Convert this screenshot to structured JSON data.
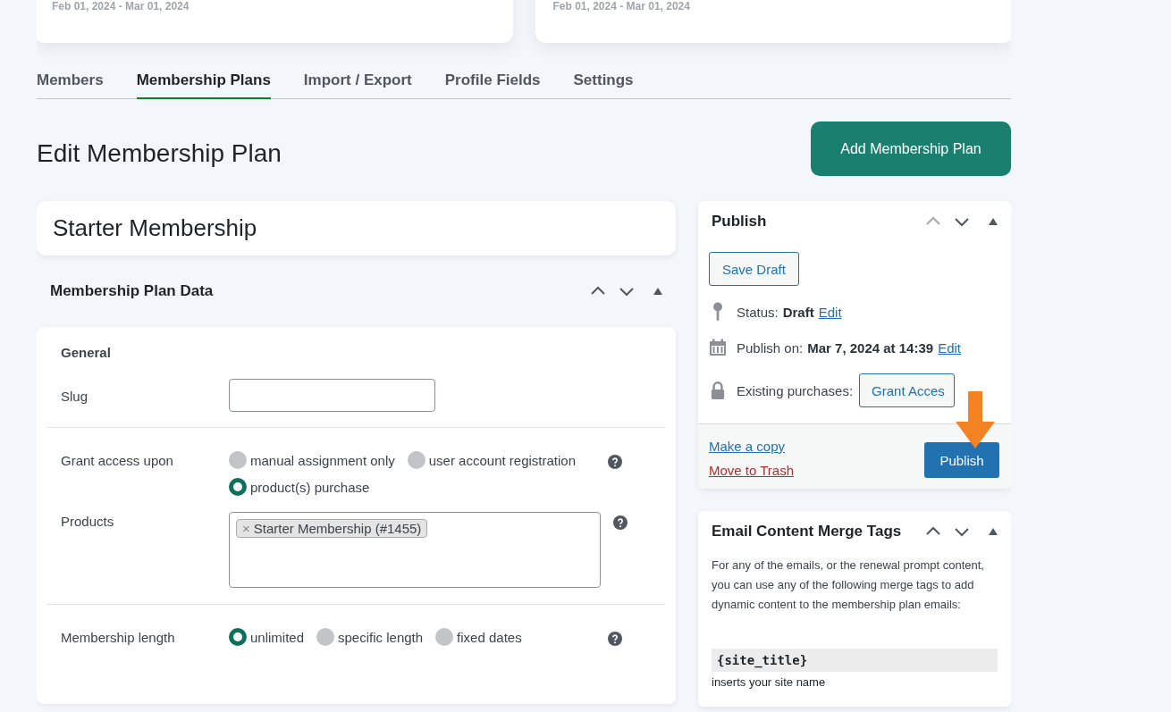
{
  "stat_cards": [
    {
      "date_range": "Feb 01, 2024 - Mar 01, 2024"
    },
    {
      "date_range": "Feb 01, 2024 - Mar 01, 2024"
    }
  ],
  "tabs": [
    {
      "label": "Members",
      "selected": false
    },
    {
      "label": "Membership Plans",
      "selected": true
    },
    {
      "label": "Import / Export",
      "selected": false
    },
    {
      "label": "Profile Fields",
      "selected": false
    },
    {
      "label": "Settings",
      "selected": false
    }
  ],
  "page_title": "Edit Membership Plan",
  "add_button": "Add Membership Plan",
  "plan_title": "Starter Membership",
  "plan_data": {
    "title": "Membership Plan Data",
    "section": "General",
    "fields": [
      {
        "kind": "text",
        "label": "Slug"
      },
      {
        "kind": "radio",
        "label": "Grant access upon",
        "help": true,
        "options": [
          {
            "label": "manual assignment only",
            "selected": false
          },
          {
            "label": "user account registration",
            "selected": false
          },
          {
            "label": "product(s) purchase",
            "selected": true
          }
        ]
      },
      {
        "kind": "tags",
        "label": "Products",
        "help": true,
        "tags": [
          "Starter Membership (#1455)"
        ],
        "remove": "×"
      },
      {
        "kind": "radio",
        "label": "Membership length",
        "help": true,
        "options": [
          {
            "label": "unlimited",
            "selected": true
          },
          {
            "label": "specific length",
            "selected": false
          },
          {
            "label": "fixed dates",
            "selected": false
          }
        ]
      }
    ]
  },
  "publish": {
    "title": "Publish",
    "save_draft": "Save Draft",
    "status_label": "Status:",
    "status": "Draft",
    "status_edit": "Edit",
    "publish_on_label": "Publish on:",
    "publish_on": "Mar 7, 2024 at 14:39",
    "publish_on_edit": "Edit",
    "purchases_label": "Existing purchases:",
    "grant_button": "Grant Acces",
    "copy_link": "Make a copy",
    "trash_link": "Move to Trash",
    "publish_button": "Publish"
  },
  "merge_tags": {
    "title": "Email Content Merge Tags",
    "intro": "For any of the emails, or the renewal prompt content, you can use any of the following merge tags to add dynamic content to the membership plan emails:",
    "tag": "{site_title}",
    "tag_desc": "inserts your site name"
  }
}
